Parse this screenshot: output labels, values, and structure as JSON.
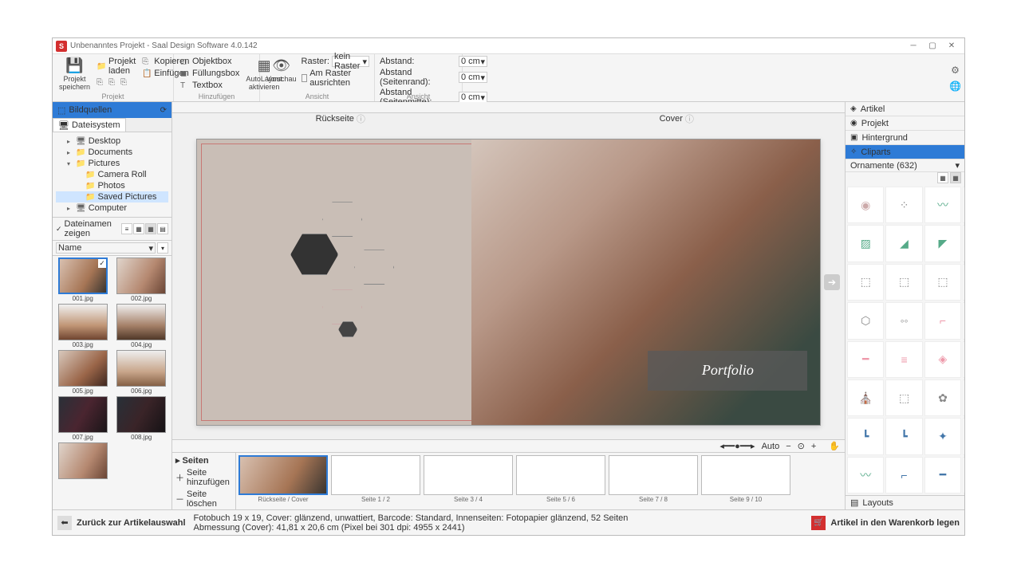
{
  "title": "Unbenanntes Projekt - Saal Design Software 4.0.142",
  "ribbon": {
    "g1": "Projekt",
    "save": "Projekt\nspeichern",
    "load": "Projekt laden",
    "copy": "Kopieren",
    "paste": "Einfügen",
    "g2": "Hinzufügen",
    "objbox": "Objektbox",
    "fillbox": "Füllungsbox",
    "textbox": "Textbox",
    "autolayout": "AutoLayout\naktivieren",
    "preview": "Vorschau",
    "g3": "Ansicht",
    "raster": "Raster:",
    "raster_val": "kein Raster",
    "snap": "Am Raster ausrichten",
    "abstand": "Abstand:",
    "seitenrand": "Abstand (Seitenrand):",
    "seitenmitte": "Abstand (Seitenmitte):",
    "cm0": "0 cm"
  },
  "left": {
    "header": "Bildquellen",
    "tab": "Dateisystem",
    "desktop": "Desktop",
    "documents": "Documents",
    "pictures": "Pictures",
    "camera": "Camera Roll",
    "photos": "Photos",
    "saved": "Saved Pictures",
    "computer": "Computer",
    "showfn": "Dateinamen zeigen",
    "sort": "Name",
    "imgs": [
      "001.jpg",
      "002.jpg",
      "003.jpg",
      "004.jpg",
      "005.jpg",
      "006.jpg",
      "007.jpg",
      "008.jpg"
    ]
  },
  "canvas": {
    "back": "Rückseite",
    "cover": "Cover",
    "portfolio": "Portfolio",
    "auto": "Auto"
  },
  "pages": {
    "hdr": "Seiten",
    "add": "Seite hinzufügen",
    "del": "Seite löschen",
    "labels": [
      "Rückseite / Cover",
      "Seite 1 / 2",
      "Seite 3 / 4",
      "Seite 5 / 6",
      "Seite 7 / 8",
      "Seite 9 / 10"
    ]
  },
  "right": {
    "artikel": "Artikel",
    "projekt": "Projekt",
    "hintergrund": "Hintergrund",
    "cliparts": "Cliparts",
    "cat": "Ornamente (632)",
    "layouts": "Layouts"
  },
  "status": {
    "back": "Zurück zur Artikelauswahl",
    "line1": "Fotobuch 19 x 19, Cover: glänzend, unwattiert, Barcode: Standard, Innenseiten: Fotopapier glänzend, 52 Seiten",
    "line2": "Abmessung (Cover): 41,81 x 20,6 cm (Pixel bei 301 dpi: 4955 x 2441)",
    "cart": "Artikel in den Warenkorb legen"
  }
}
